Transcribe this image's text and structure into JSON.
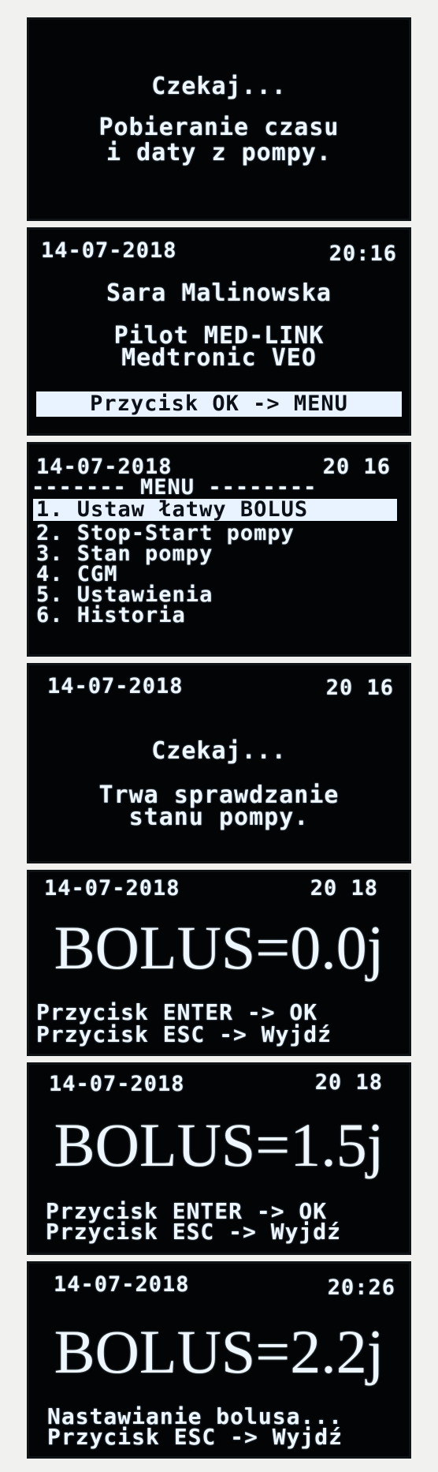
{
  "screens": {
    "s1": {
      "wait": "Czekaj...",
      "line1": "Pobieranie czasu",
      "line2": "i daty z pompy."
    },
    "s2": {
      "date": "14-07-2018",
      "time": "20:16",
      "name": "Sara Malinowska",
      "line1": "Pilot MED-LINK",
      "line2": "Medtronic VEO",
      "footer": "Przycisk OK -> MENU"
    },
    "s3": {
      "date": "14-07-2018",
      "time": "20 16",
      "header": "------- MENU --------",
      "items": [
        "1. Ustaw łatwy BOLUS",
        "2. Stop-Start pompy",
        "3. Stan pompy",
        "4. CGM",
        "5. Ustawienia",
        "6. Historia"
      ]
    },
    "s4": {
      "date": "14-07-2018",
      "time": "20 16",
      "wait": "Czekaj...",
      "line1": "Trwa sprawdzanie",
      "line2": "stanu pompy."
    },
    "s5": {
      "date": "14-07-2018",
      "time": "20 18",
      "bolus": "BOLUS=0.0j",
      "line1": "Przycisk ENTER -> OK",
      "line2": "Przycisk ESC -> Wyjdź"
    },
    "s6": {
      "date": "14-07-2018",
      "time": "20 18",
      "bolus": "BOLUS=1.5j",
      "line1": "Przycisk ENTER -> OK",
      "line2": "Przycisk ESC -> Wyjdź"
    },
    "s7": {
      "date": "14-07-2018",
      "time": "20:26",
      "bolus": "BOLUS=2.2j",
      "line1": "Nastawianie bolusa...",
      "line2": "Przycisk ESC -> Wyjdź"
    }
  }
}
